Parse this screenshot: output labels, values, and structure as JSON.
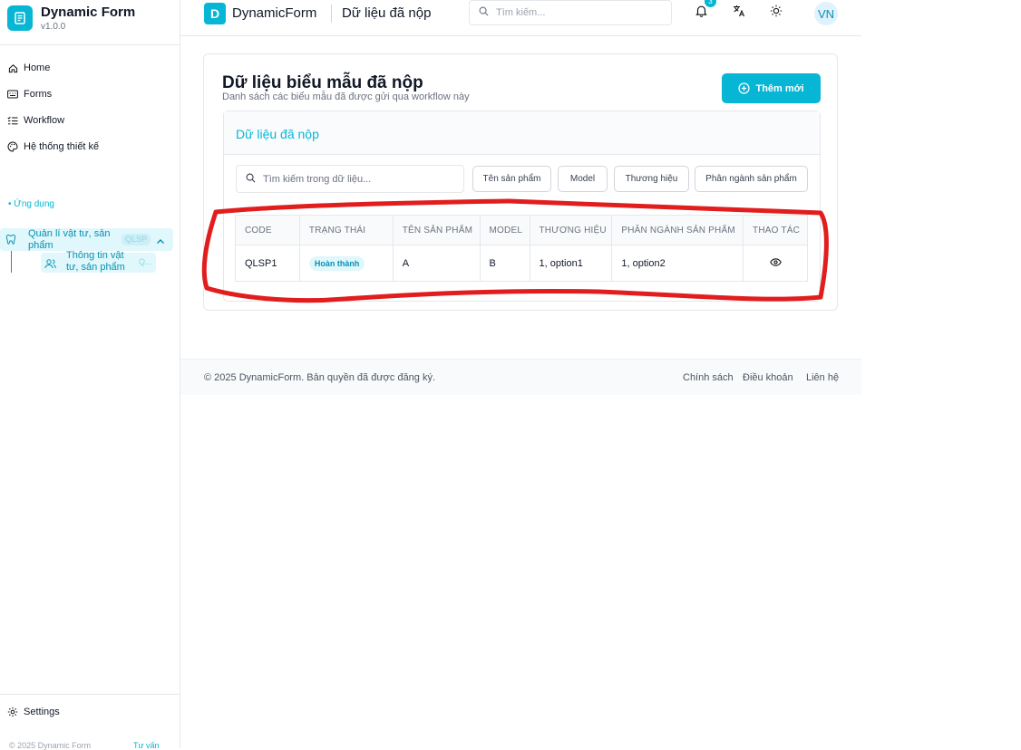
{
  "sidebar": {
    "brand_title": "Dynamic Form",
    "brand_version": "v1.0.0",
    "nav": [
      {
        "label": "Home",
        "icon": "home-icon"
      },
      {
        "label": "Forms",
        "icon": "keyboard-icon"
      },
      {
        "label": "Workflow",
        "icon": "list-check-icon"
      },
      {
        "label": "Hệ thống thiết kế",
        "icon": "palette-icon"
      }
    ],
    "section_label": "• Ứng dụng",
    "app_group": {
      "label": "Quản lí vật tư, sản phẩm",
      "badge": "QLSP"
    },
    "sub_item": {
      "label": "Thông tin vật tư, sản phẩm",
      "badge": "Q..."
    },
    "settings_label": "Settings",
    "copyright": "© 2025 Dynamic Form",
    "bottom_link": "Tư vấn"
  },
  "header": {
    "logo_letter": "D",
    "app_name": "DynamicForm",
    "page_title": "Dữ liệu đã nộp",
    "search_placeholder": "Tìm kiếm...",
    "notification_count": "3",
    "avatar_initials": "VN"
  },
  "main": {
    "title": "Dữ liệu biểu mẫu đã nộp",
    "subtitle": "Danh sách các biểu mẫu đã được gửi qua workflow này",
    "add_button": "Thêm mới",
    "panel_title": "Dữ liệu đã nộp",
    "filter_placeholder": "Tìm kiếm trong dữ liệu...",
    "filter_chips": [
      "Tên sản phẩm",
      "Model",
      "Thương hiệu",
      "Phân ngành sản phẩm"
    ],
    "table": {
      "columns": [
        "CODE",
        "TRẠNG THÁI",
        "TÊN SẢN PHẨM",
        "MODEL",
        "THƯƠNG HIỆU",
        "PHÂN NGÀNH SẢN PHẨM",
        "THAO TÁC"
      ],
      "rows": [
        {
          "code": "QLSP1",
          "status": "Hoàn thành",
          "name": "A",
          "model": "B",
          "brand": "1, option1",
          "category": "1, option2"
        }
      ]
    }
  },
  "footer": {
    "copyright": "© 2025 DynamicForm. Bản quyền đã được đăng ký.",
    "links": [
      "Chính sách",
      "Điều khoản",
      "Liên hệ"
    ]
  },
  "colors": {
    "accent": "#06b6d4",
    "annotation": "#e11d1d"
  }
}
